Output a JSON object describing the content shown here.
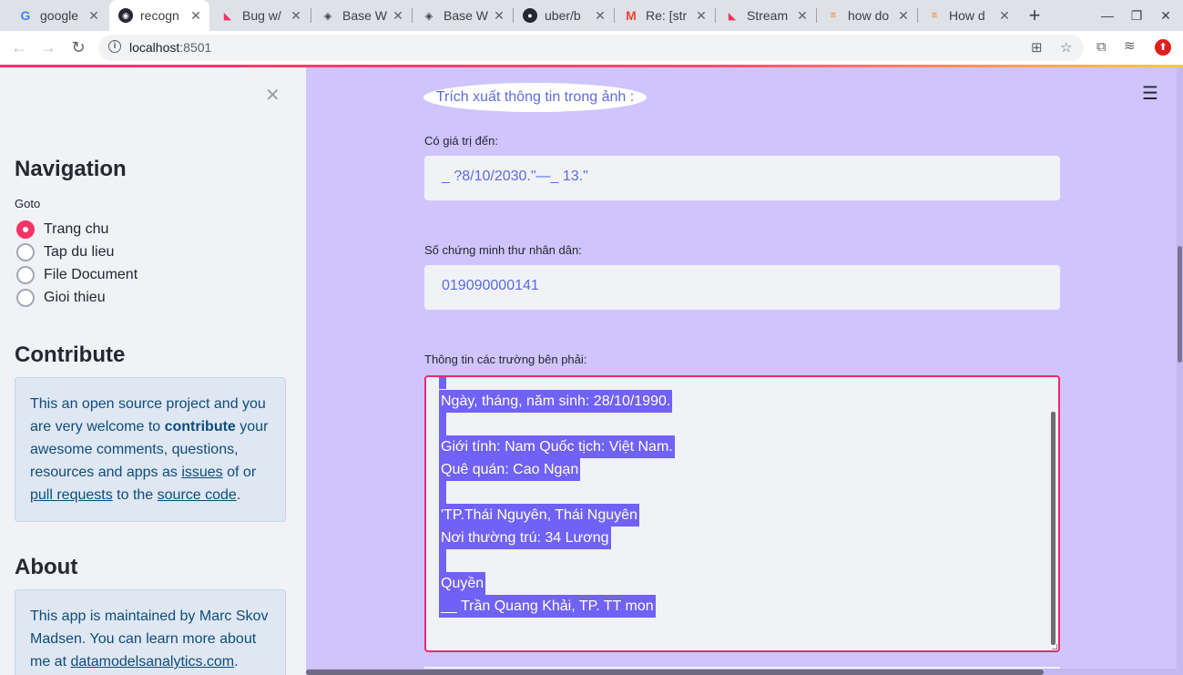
{
  "browser": {
    "tabs": [
      {
        "label": "google",
        "icon": "google-icon",
        "active": false
      },
      {
        "label": "recogn",
        "icon": "streamlit-icon",
        "active": true
      },
      {
        "label": "Bug w/",
        "icon": "streamlit-icon",
        "active": false
      },
      {
        "label": "Base W",
        "icon": "diamond-icon",
        "active": false
      },
      {
        "label": "Base W",
        "icon": "diamond-icon",
        "active": false
      },
      {
        "label": "uber/b",
        "icon": "github-icon",
        "active": false
      },
      {
        "label": "Re: [str",
        "icon": "gmail-icon",
        "active": false
      },
      {
        "label": "Stream",
        "icon": "streamlit-icon",
        "active": false
      },
      {
        "label": "how do",
        "icon": "stackoverflow-icon",
        "active": false
      },
      {
        "label": "How d",
        "icon": "stackoverflow-icon",
        "active": false
      }
    ],
    "url_host": "localhost",
    "url_port": ":8501",
    "accent_colors": [
      "#ff2d6f",
      "#ffc94a"
    ]
  },
  "sidebar": {
    "navigation_title": "Navigation",
    "goto_label": "Goto",
    "options": [
      {
        "label": "Trang chu",
        "checked": true
      },
      {
        "label": "Tap du lieu",
        "checked": false
      },
      {
        "label": "File Document",
        "checked": false
      },
      {
        "label": "Gioi thieu",
        "checked": false
      }
    ],
    "contribute_title": "Contribute",
    "contribute": {
      "t1": "This an open source project and you are very welcome to ",
      "bold": "contribute",
      "t2": " your awesome comments, questions, resources and apps as ",
      "link1": "issues",
      "t3": " of or ",
      "link2": "pull requests",
      "t4": " to the ",
      "link3": "source code",
      "t5": "."
    },
    "about_title": "About",
    "about": {
      "t1": "This app is maintained by Marc Skov Madsen. You can learn more about me at ",
      "link": "datamodelsanalytics.com",
      "t2": "."
    }
  },
  "main": {
    "header_pill": "Trích xuất thông tin trong ảnh :",
    "expiry_label": "Có giá trị đến:",
    "expiry_value": "_ ?8/10/2030.\"—_ 13.\"",
    "id_label": "Số chứng minh thư nhân dân:",
    "id_value": "019090000141",
    "fields_label": "Thông tin các trường bên phải:",
    "textarea_lines": [
      "Ngày, tháng, năm sinh: 28/10/1990.",
      "",
      "Giới tính: Nam Quốc tịch: Việt Nam.",
      "Quê quán: Cao Ngạn",
      "",
      "'TP.Thái Nguyên, Thái Nguyên",
      "Nơi thường trú: 34 Lương",
      "",
      "Quyền",
      "__ Trần Quang Khải, TP. TT mon"
    ],
    "background_color": "#d0c4fd",
    "highlight_color": "#7062f5"
  }
}
